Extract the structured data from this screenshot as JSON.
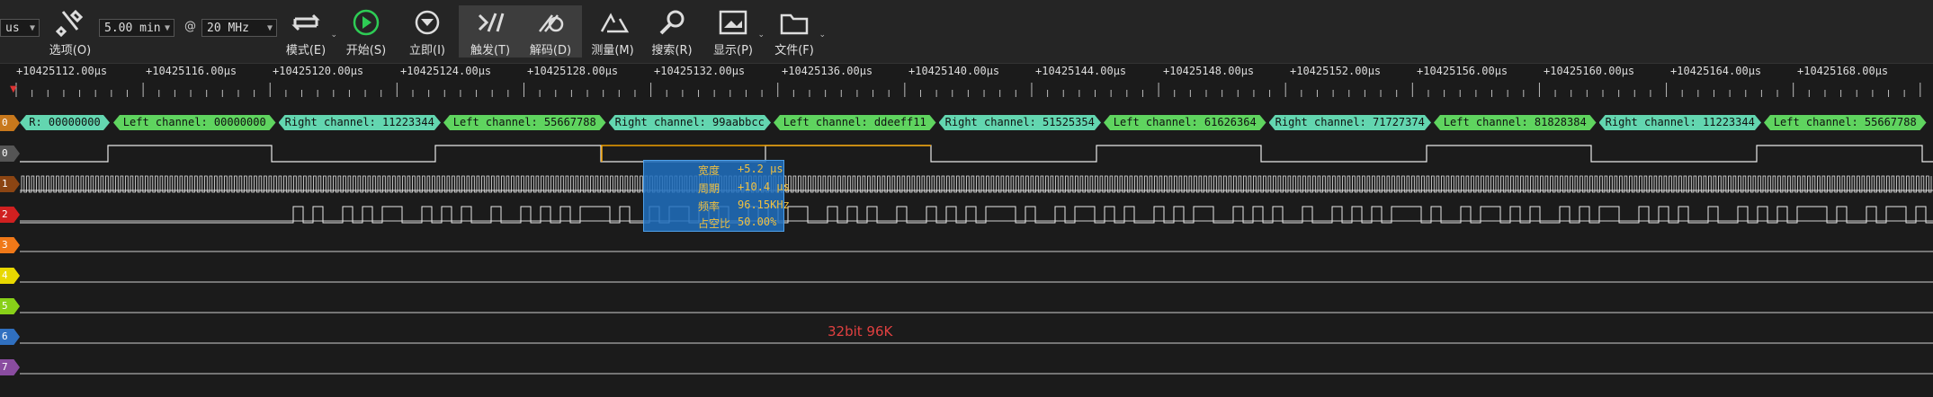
{
  "toolbar": {
    "unit_select": "us",
    "duration_select": "5.00 min",
    "at_symbol": "@",
    "rate_select": "20 MHz",
    "buttons": [
      {
        "label": "选项(O)",
        "icon": "wrench-icon"
      },
      {
        "label": "模式(E)",
        "icon": "loop-icon"
      },
      {
        "label": "开始(S)",
        "icon": "play-icon"
      },
      {
        "label": "立即(I)",
        "icon": "immediate-icon"
      },
      {
        "label": "触发(T)",
        "icon": "trigger-icon"
      },
      {
        "label": "解码(D)",
        "icon": "decode-icon"
      },
      {
        "label": "测量(M)",
        "icon": "measure-icon"
      },
      {
        "label": "搜索(R)",
        "icon": "search-icon"
      },
      {
        "label": "显示(P)",
        "icon": "display-icon"
      },
      {
        "label": "文件(F)",
        "icon": "folder-icon"
      }
    ]
  },
  "ruler": {
    "labels": [
      "+10425112.00µs",
      "+10425116.00µs",
      "+10425120.00µs",
      "+10425124.00µs",
      "+10425128.00µs",
      "+10425132.00µs",
      "+10425136.00µs",
      "+10425140.00µs",
      "+10425144.00µs",
      "+10425148.00µs",
      "+10425152.00µs",
      "+10425156.00µs",
      "+10425160.00µs",
      "+10425164.00µs",
      "+10425168.00µs"
    ]
  },
  "channels": [
    {
      "id": "0",
      "color": "#c8781c"
    },
    {
      "id": "0",
      "color": "#555555"
    },
    {
      "id": "1",
      "color": "#8b4513"
    },
    {
      "id": "2",
      "color": "#d02020"
    },
    {
      "id": "3",
      "color": "#f07818"
    },
    {
      "id": "4",
      "color": "#e8d800"
    },
    {
      "id": "5",
      "color": "#88d018"
    },
    {
      "id": "6",
      "color": "#3070c0"
    },
    {
      "id": "7",
      "color": "#8a4ca0"
    }
  ],
  "decode_frames": [
    {
      "text": "R: 00000000",
      "type": "right"
    },
    {
      "text": "Left channel: 00000000",
      "type": "left"
    },
    {
      "text": "Right channel: 11223344",
      "type": "right"
    },
    {
      "text": "Left channel: 55667788",
      "type": "left"
    },
    {
      "text": "Right channel: 99aabbcc",
      "type": "right"
    },
    {
      "text": "Left channel: ddeeff11",
      "type": "left"
    },
    {
      "text": "Right channel: 51525354",
      "type": "right"
    },
    {
      "text": "Left channel: 61626364",
      "type": "left"
    },
    {
      "text": "Right channel: 71727374",
      "type": "right"
    },
    {
      "text": "Left channel: 81828384",
      "type": "left"
    },
    {
      "text": "Right channel: 11223344",
      "type": "right"
    },
    {
      "text": "Left channel: 55667788",
      "type": "left"
    }
  ],
  "tooltip": {
    "rows": [
      {
        "key": "宽度",
        "value": "+5.2 µs"
      },
      {
        "key": "周期",
        "value": "+10.4 µs"
      },
      {
        "key": "频率",
        "value": "96.15KHz"
      },
      {
        "key": "占空比",
        "value": "50.00%"
      }
    ]
  },
  "annotation": "32bit  96K",
  "colors": {
    "background": "#1b1b1b",
    "toolbar": "#252525",
    "trace": "#e8e8e8",
    "highlight": "#f0a000"
  }
}
